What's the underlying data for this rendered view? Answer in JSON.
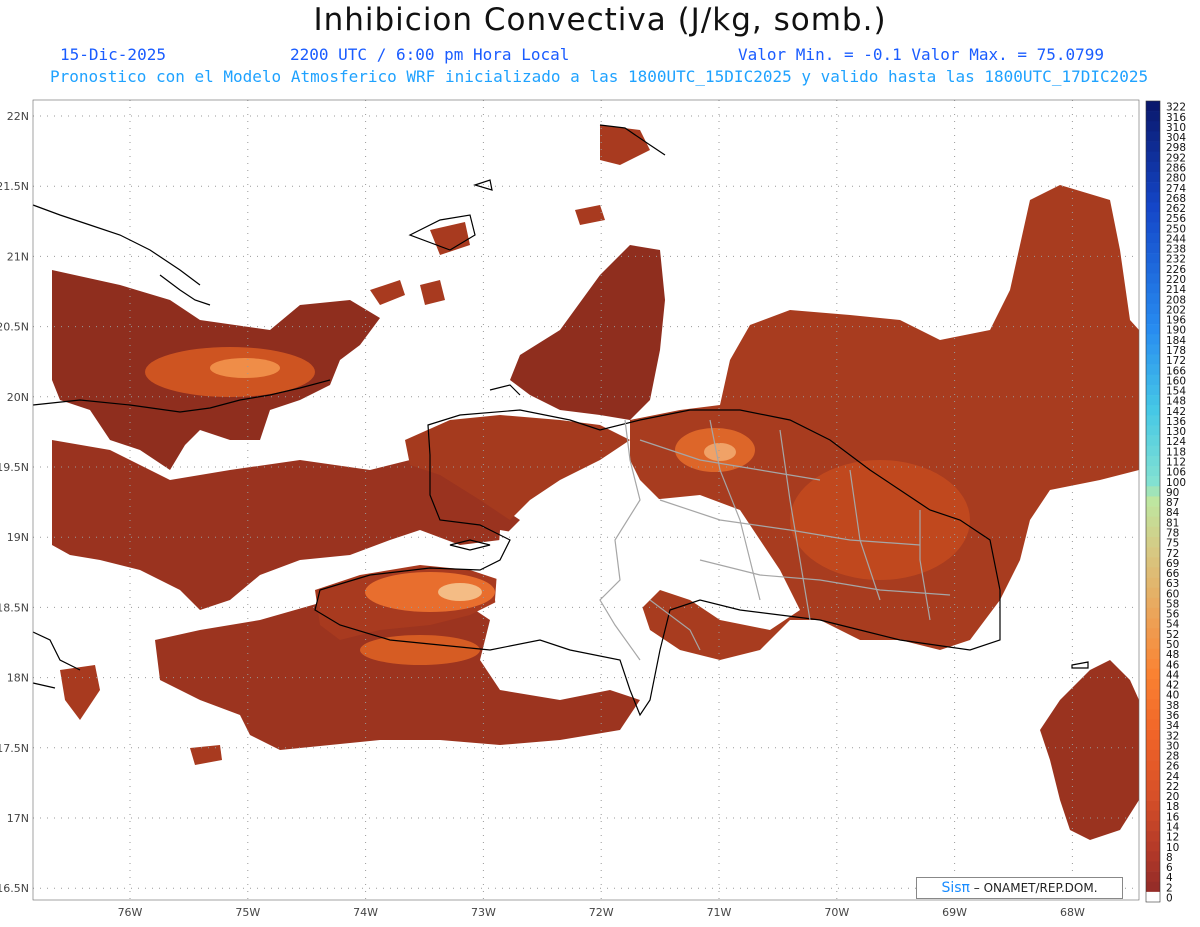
{
  "header": {
    "title": "Inhibicion Convectiva (J/kg, somb.)",
    "date": "15-Dic-2025",
    "time": "2200 UTC / 6:00 pm Hora Local",
    "min_max": "Valor Min. = -0.1   Valor Max. = 75.0799",
    "forecast_info": "Pronostico con el Modelo Atmosferico WRF inicializado a las 1800UTC_15DIC2025 y valido hasta las  1800UTC_17DIC2025"
  },
  "map": {
    "lat_labels": [
      "22N",
      "21.5N",
      "21N",
      "20.5N",
      "20N",
      "19.5N",
      "19N",
      "18.5N",
      "18N",
      "17.5N",
      "17N",
      "16.5N"
    ],
    "lon_labels": [
      "76W",
      "75W",
      "74W",
      "73W",
      "72W",
      "71W",
      "70W",
      "69W",
      "68W"
    ],
    "shading_colors": {
      "low": "#8b2b1f",
      "mid": "#c2431f",
      "high": "#f07a32",
      "peak": "#f4b27a"
    },
    "border_color": "#000000",
    "province_color": "#a6a6a6"
  },
  "colorbar": {
    "labels": [
      "322",
      "316",
      "310",
      "304",
      "298",
      "292",
      "286",
      "280",
      "274",
      "268",
      "262",
      "256",
      "250",
      "244",
      "238",
      "232",
      "226",
      "220",
      "214",
      "208",
      "202",
      "196",
      "190",
      "184",
      "178",
      "172",
      "166",
      "160",
      "154",
      "148",
      "142",
      "136",
      "130",
      "124",
      "118",
      "112",
      "106",
      "100",
      "90",
      "87",
      "84",
      "81",
      "78",
      "75",
      "72",
      "69",
      "66",
      "63",
      "60",
      "58",
      "56",
      "54",
      "52",
      "50",
      "48",
      "46",
      "44",
      "42",
      "40",
      "38",
      "36",
      "34",
      "32",
      "30",
      "28",
      "26",
      "24",
      "22",
      "20",
      "18",
      "16",
      "14",
      "12",
      "10",
      "8",
      "6",
      "4",
      "2",
      "0"
    ]
  },
  "credit": {
    "brand": "Sisπ",
    "text": "– ONAMET/REP.DOM."
  }
}
